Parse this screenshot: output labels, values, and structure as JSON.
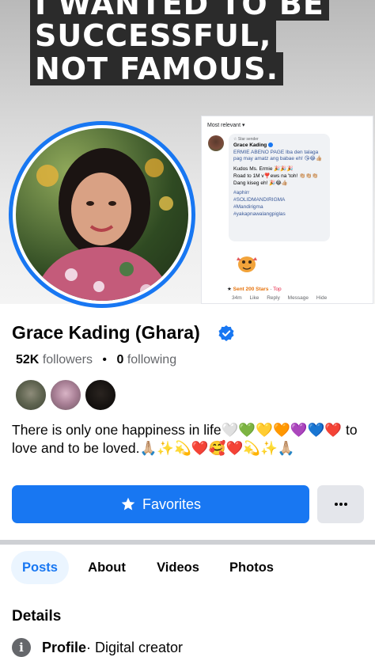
{
  "cover": {
    "lines": [
      "I WANTED TO BE",
      "SUCCESSFUL,",
      "NOT FAMOUS."
    ]
  },
  "comment_card": {
    "sort_label": "Most relevant ▾",
    "badge": "Star sender",
    "author": "Grace Kading",
    "line1": "ERMIE ABENO PAGE Iba den talaga pag may amatz ang babae eh! 😘😂👍🏼",
    "line2": "Kudos Ms. Ermie 🎉🎉🎉",
    "line3": "Road to 1M v❣️ews na 'toh! 👏🏼👏🏼👏🏼",
    "line4": "Dang kiseg eh! 🎉😂👍🏼",
    "hashtags": [
      "#aphirr",
      "#SOLIDMANDIRIGMA",
      "#Mandirigma",
      "#yakapnawalangpiglas"
    ],
    "stars": "Sent 200 Stars",
    "top": "Top",
    "time": "34m",
    "actions": [
      "Like",
      "Reply",
      "Message",
      "Hide"
    ]
  },
  "profile": {
    "name": "Grace Kading (Ghara)",
    "followers_count": "52K",
    "followers_label": "followers",
    "following_count": "0",
    "following_label": "following",
    "bio": "There is only one happiness in life🤍💚💛🧡💜💙❤️ to love and to be loved.🙏🏼✨💫❤️🥰❤️💫✨🙏🏼"
  },
  "actions": {
    "favorites_label": "Favorites",
    "more_label": "···"
  },
  "tabs": [
    {
      "label": "Posts",
      "active": true
    },
    {
      "label": "About",
      "active": false
    },
    {
      "label": "Videos",
      "active": false
    },
    {
      "label": "Photos",
      "active": false
    }
  ],
  "details": {
    "title": "Details",
    "profile_label": "Profile",
    "profile_value": " · Digital creator"
  },
  "colors": {
    "accent": "#1877f2",
    "secondary_text": "#65676b",
    "button_gray": "#e4e6eb"
  }
}
